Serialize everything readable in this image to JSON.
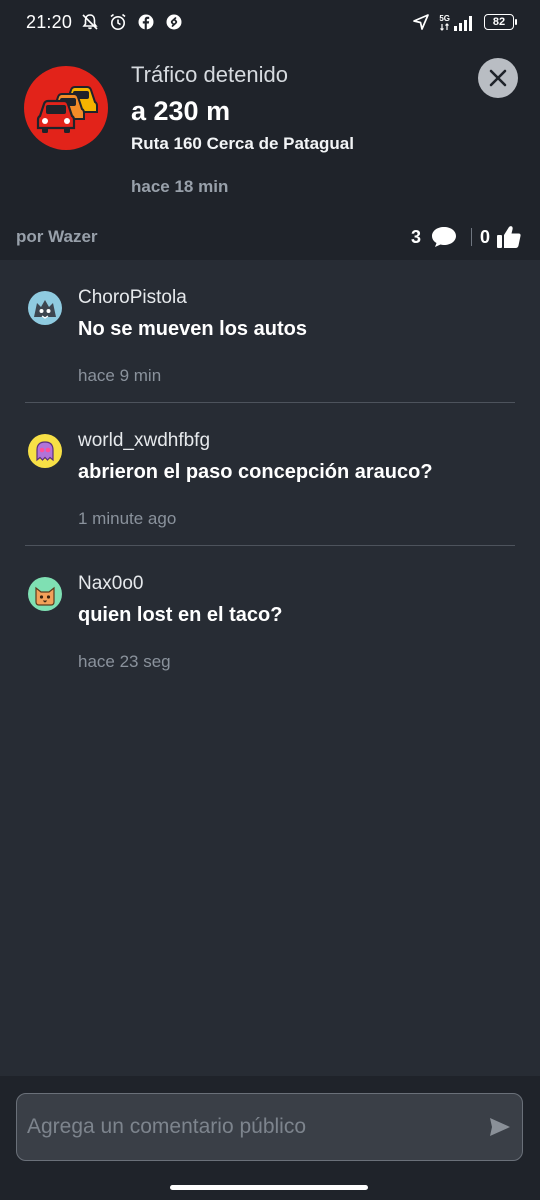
{
  "status_bar": {
    "time": "21:20",
    "network": "5G",
    "battery": "82",
    "icons": [
      "do-not-disturb-icon",
      "alarm-icon",
      "facebook-icon",
      "shazam-icon",
      "navigation-arrow-icon",
      "signal-icon",
      "battery-icon"
    ]
  },
  "alert": {
    "type": "Tráfico detenido",
    "distance": "a 230 m",
    "location": "Ruta 160 Cerca de Patagual",
    "time_ago": "hace 18 min",
    "reporter": "por Wazer",
    "comment_count": "3",
    "thumbs_count": "0",
    "icon": "traffic-jam-cars-icon",
    "accent_color": "#e2231a"
  },
  "comments": [
    {
      "user": "ChoroPistola",
      "text": "No se mueven los autos",
      "time": "hace 9 min",
      "avatar_color": "#8fcbe0",
      "avatar_icon": "wolf-mood-icon"
    },
    {
      "user": "world_xwdhfbfg",
      "text": "abrieron el paso concepción arauco?",
      "time": "1 minute ago",
      "avatar_color": "#f7e046",
      "avatar_icon": "purple-ghost-mood-icon"
    },
    {
      "user": "Nax0o0",
      "text": "quien lost en el taco?",
      "time": "hace 23 seg",
      "avatar_color": "#7fe0b3",
      "avatar_icon": "cat-mood-icon"
    }
  ],
  "input": {
    "placeholder": "Agrega un comentario público"
  }
}
